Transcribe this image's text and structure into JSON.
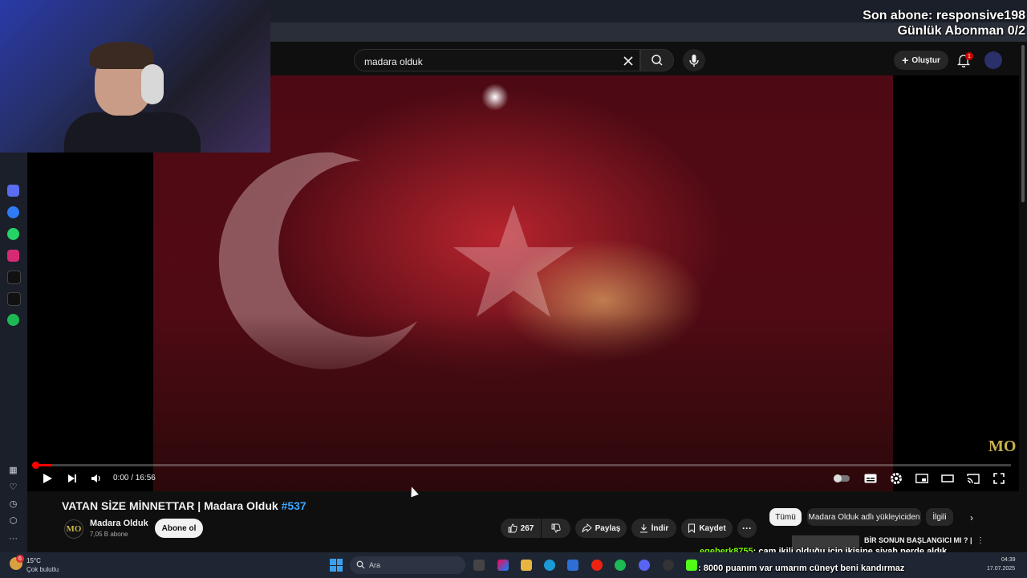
{
  "overlay": {
    "last_sub": "Son abone: responsive198",
    "daily_goal": "Günlük Abonman 0/2"
  },
  "header": {
    "search_value": "madara olduk",
    "create_label": "Oluştur",
    "notifications_count": "1"
  },
  "player": {
    "time": "0:00 / 16:56",
    "progress_fraction": 0.017,
    "watermark": "MO"
  },
  "video": {
    "title": "VATAN SİZE MİNNETTAR | Madara Olduk",
    "hashtag": "#537",
    "channel_name": "Madara Olduk",
    "channel_avatar": "MO",
    "subscribers": "7,05 B abone",
    "subscribe_label": "Abone ol",
    "likes": "267",
    "share_label": "Paylaş",
    "download_label": "İndir",
    "save_label": "Kaydet"
  },
  "recommendations": {
    "chips": [
      "Tümü",
      "Madara Olduk adlı yükleyiciden",
      "İlgili"
    ],
    "first_title": "BİR SONUN BAŞLANGICI MI ? |"
  },
  "chat": [
    {
      "user": "egeberk8755",
      "message": ": cam ikili olduğu için ikisine siyah perde aldık"
    },
    {
      "user": "",
      "message": ": 8000 puanım var umarım cüneyt beni kandırmaz"
    }
  ],
  "taskbar": {
    "weather_temp": "15°C",
    "weather_desc": "Çok bulutlu",
    "weather_badge": "6",
    "search_label": "Ara",
    "time": "04:39",
    "date": "17.07.2025"
  },
  "colors": {
    "accent_red": "#ff0000",
    "link_blue": "#3ea6ff",
    "chat_user": "#7cfc00"
  }
}
